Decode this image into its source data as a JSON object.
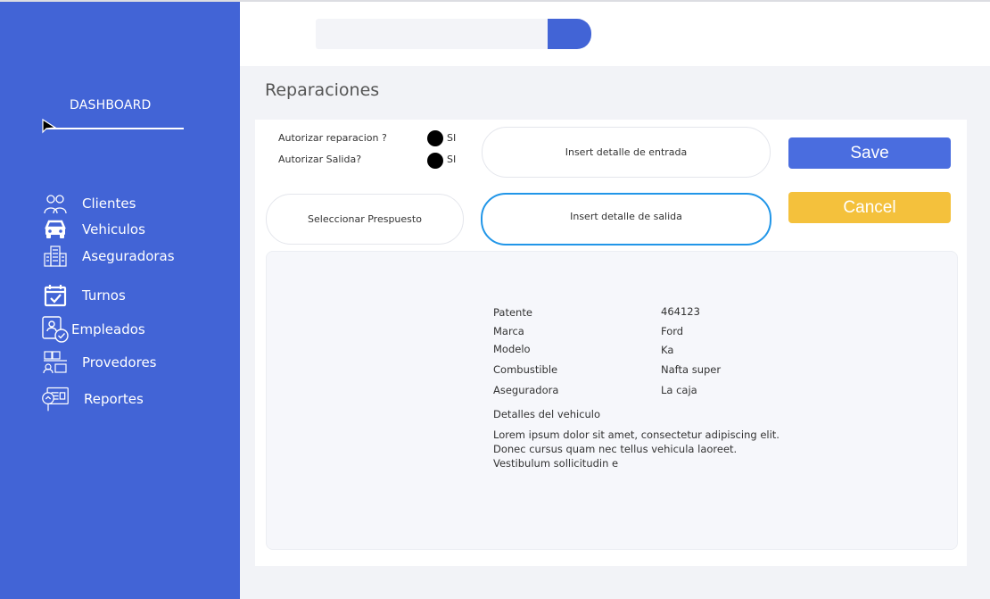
{
  "sidebar": {
    "title": "DASHBOARD",
    "items": [
      {
        "label": "Clientes",
        "icon": "clients-icon"
      },
      {
        "label": "Vehiculos",
        "icon": "car-icon"
      },
      {
        "label": "Aseguradoras",
        "icon": "building-icon"
      },
      {
        "label": "Turnos",
        "icon": "calendar-check-icon"
      },
      {
        "label": "Empleados",
        "icon": "employee-badge-icon"
      },
      {
        "label": "Provedores",
        "icon": "supplier-truck-icon"
      },
      {
        "label": "Reportes",
        "icon": "report-search-icon"
      }
    ]
  },
  "search": {
    "value": "",
    "placeholder": ""
  },
  "page": {
    "title": "Reparaciones"
  },
  "form": {
    "autorizar_reparacion": "Autorizar reparacion ?",
    "autorizar_salida": "Autorizar Salida?",
    "si_label": "SI",
    "entrada_label": "Insert detalle de entrada",
    "salida_label": "Insert detalle de salida",
    "presupuesto_label": "Seleccionar Prespuesto",
    "save_label": "Save",
    "cancel_label": "Cancel"
  },
  "vehicle": {
    "fields": [
      {
        "label": "Patente",
        "value": "464123"
      },
      {
        "label": "Marca",
        "value": "Ford"
      },
      {
        "label": "Modelo",
        "value": "Ka"
      },
      {
        "label": "Combustible",
        "value": "Nafta super"
      },
      {
        "label": "Aseguradora",
        "value": "La caja"
      }
    ],
    "details_label": "Detalles del vehiculo",
    "details_text": "Lorem ipsum dolor sit amet, consectetur adipiscing elit. Donec cursus quam nec tellus vehicula laoreet. Vestibulum sollicitudin e"
  },
  "colors": {
    "sidebar": "#4264d6",
    "save": "#4a6ddf",
    "cancel": "#f4c13c",
    "active_border": "#2196e8"
  }
}
